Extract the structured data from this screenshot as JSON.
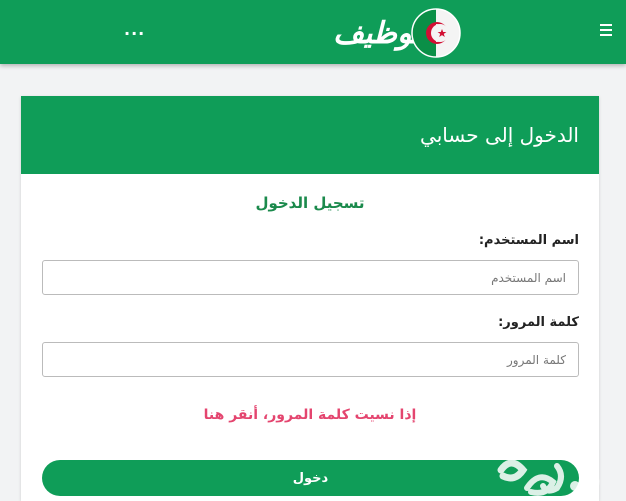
{
  "header": {
    "logo_text": "توظيف",
    "more_label": "...",
    "brand_color": "#0f9d58"
  },
  "card": {
    "title": "الدخول إلى حسابي",
    "form_title": "تسجيل الدخول",
    "username": {
      "label": "اسم المستخدم:",
      "placeholder": "اسم المستخدم",
      "value": ""
    },
    "password": {
      "label": "كلمة المرور:",
      "placeholder": "كلمة المرور",
      "value": ""
    },
    "forgot_link": "إذا نسيت كلمة المرور، أنقر هنا",
    "submit_label": "دخول",
    "accent_color": "#e4456f"
  }
}
